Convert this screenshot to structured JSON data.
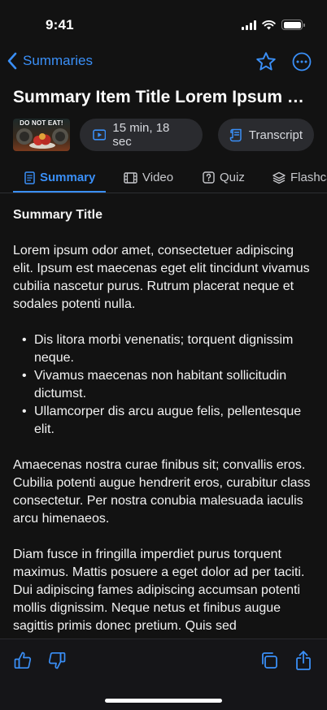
{
  "status_bar": {
    "time": "9:41"
  },
  "nav": {
    "back_label": "Summaries"
  },
  "title": "Summary Item Title Lorem Ipsum Dolor Sit",
  "thumbnail": {
    "caption": "DO NOT EAT!"
  },
  "meta": {
    "duration": "15 min, 18 sec",
    "transcript_label": "Transcript"
  },
  "tabs": [
    {
      "label": "Summary",
      "icon": "document-icon",
      "active": true
    },
    {
      "label": "Video",
      "icon": "film-icon",
      "active": false
    },
    {
      "label": "Quiz",
      "icon": "question-icon",
      "active": false
    },
    {
      "label": "Flashcards",
      "icon": "stack-icon",
      "active": false
    }
  ],
  "content": {
    "heading": "Summary Title",
    "p1": "Lorem ipsum odor amet, consectetuer adipiscing elit. Ipsum est maecenas eget elit tincidunt vivamus cubilia nascetur purus. Rutrum placerat neque et sodales potenti nulla.",
    "bullets": [
      "Dis litora morbi venenatis; torquent dignissim neque.",
      "Vivamus maecenas non habitant sollicitudin dictumst.",
      "Ullamcorper dis arcu augue felis, pellentesque elit."
    ],
    "p2": "Amaecenas nostra curae finibus sit; convallis eros. Cubilia potenti augue hendrerit eros, curabitur class consectetur. Per nostra conubia malesuada iaculis arcu himenaeos.",
    "p3": "Diam fusce in fringilla imperdiet purus torquent maximus. Mattis posuere a eget dolor ad per taciti. Dui adipiscing fames adipiscing accumsan potenti mollis dignissim. Neque netus et finibus augue sagittis primis donec pretium. Quis sed"
  },
  "colors": {
    "accent": "#3a8ff7",
    "background": "#121212",
    "pill": "#2a2b2f"
  }
}
